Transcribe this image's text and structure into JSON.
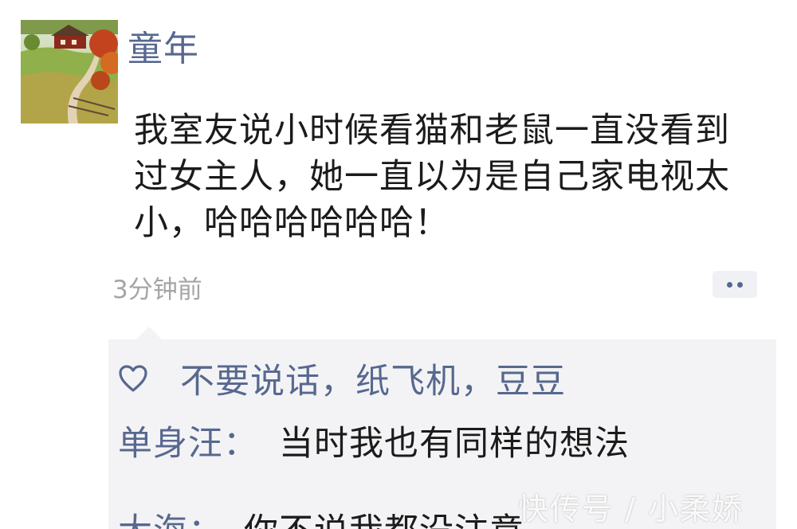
{
  "post": {
    "username": "童年",
    "text": "我室友说小时候看猫和老鼠一直没看到过女主人，她一直以为是自己家电视太小，哈哈哈哈哈哈！",
    "timestamp": "3分钟前",
    "avatar_icon": "farmhouse-landscape-avatar",
    "more_icon": "more-dots-icon"
  },
  "likes": {
    "icon": "heart-outline-icon",
    "names": "不要说话，纸飞机，豆豆"
  },
  "comments": [
    {
      "author": "单身汪",
      "separator": "：",
      "body": "当时我也有同样的想法"
    },
    {
      "author": "大海",
      "separator": "：",
      "body": "你不说我都没注意"
    }
  ],
  "watermark": "快传号 / 小柔娇",
  "colors": {
    "link_blue": "#57688f",
    "text_dark": "#1b1b1b",
    "timestamp_gray": "#a5a5a5",
    "comment_bg": "#f3f3f5"
  }
}
